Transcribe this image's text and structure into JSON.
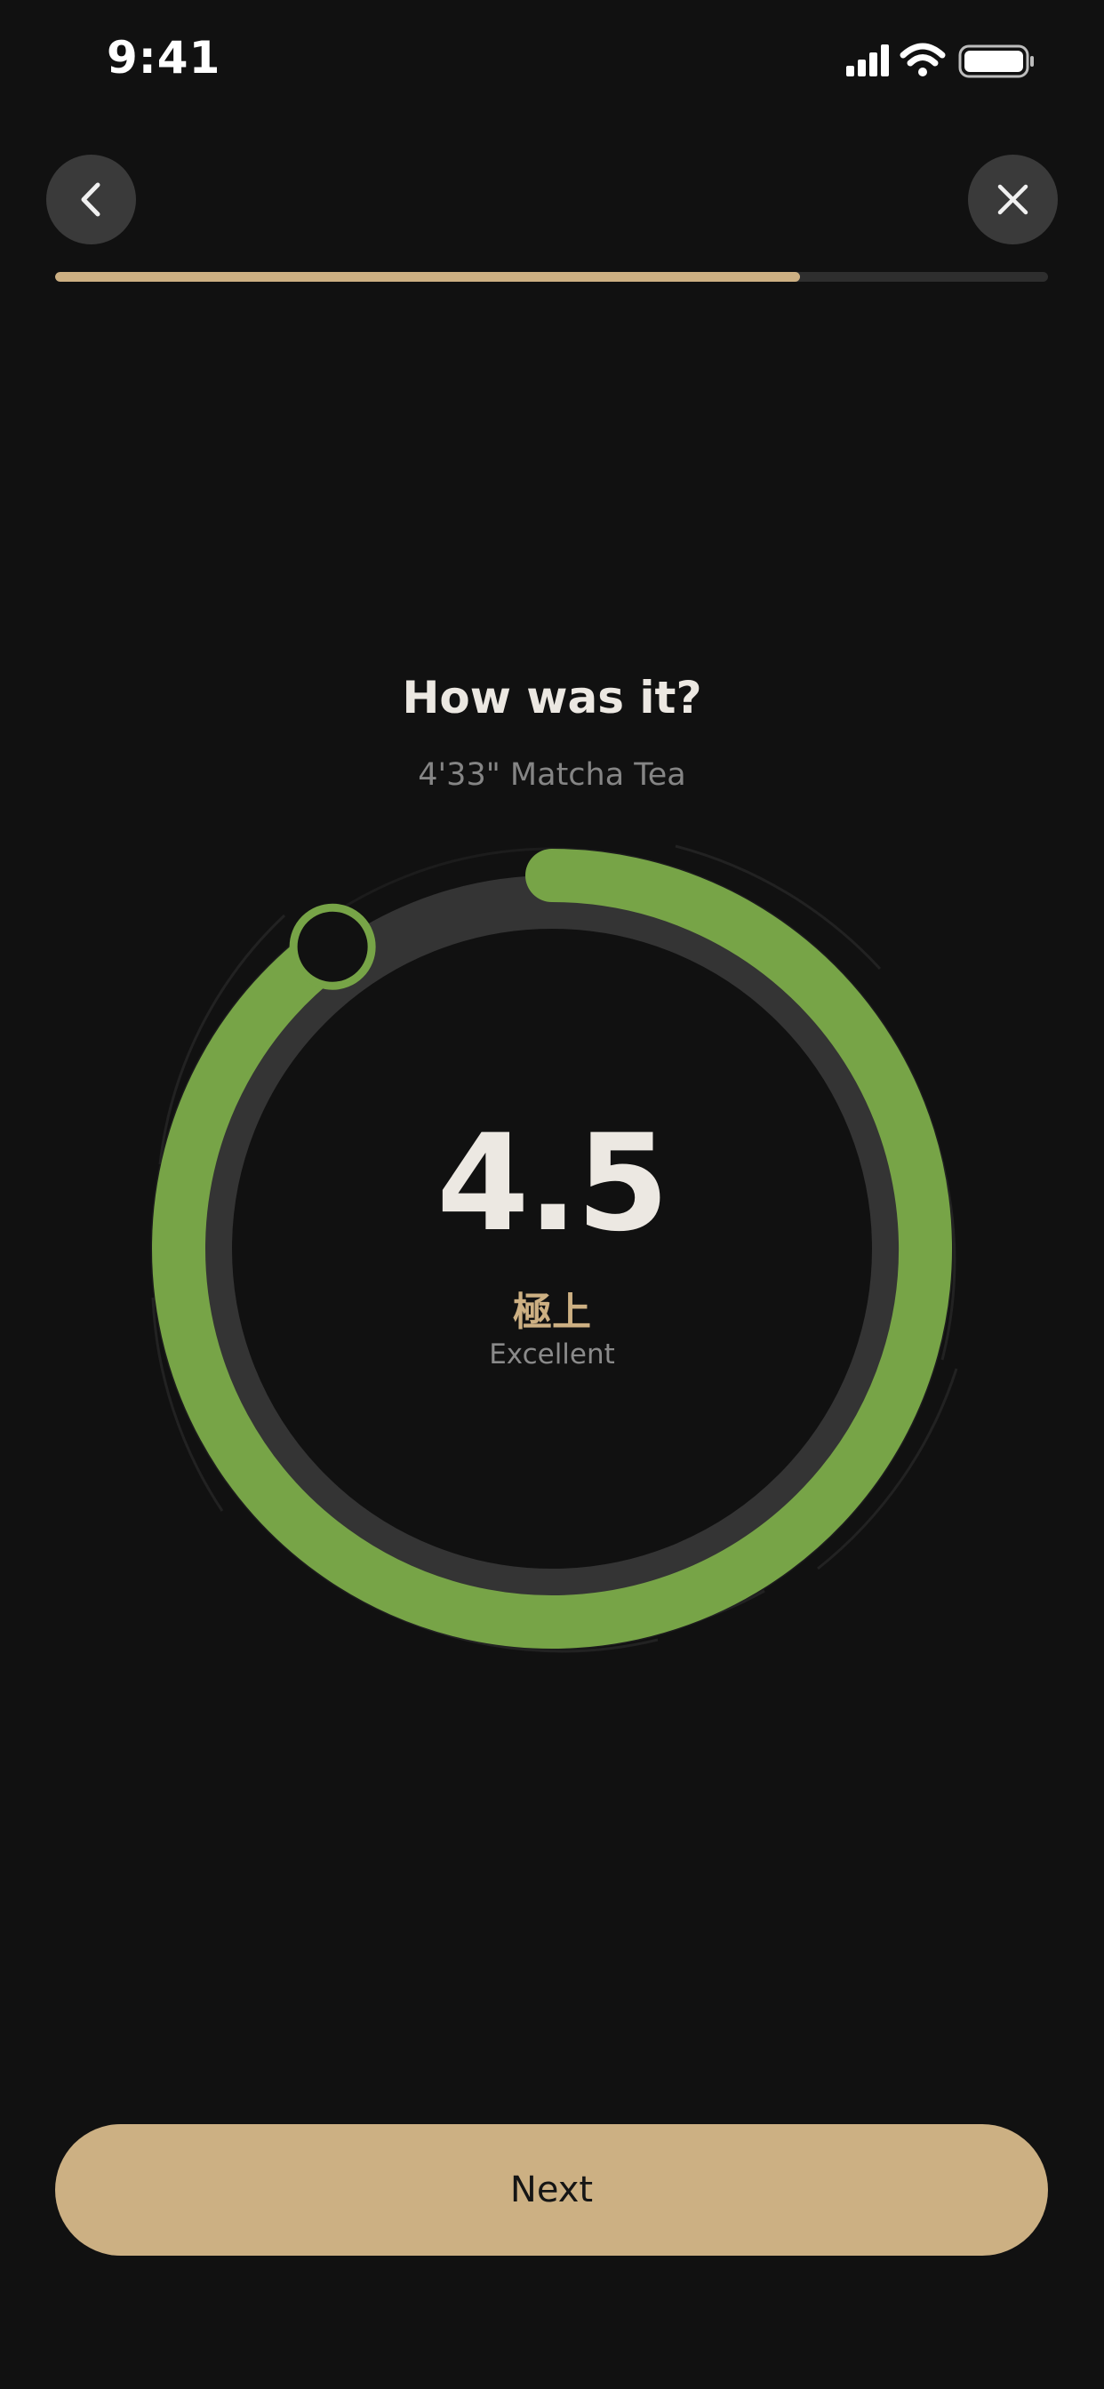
{
  "status_bar": {
    "time": "9:41",
    "icons": [
      "cellular-signal-icon",
      "wifi-icon",
      "battery-icon"
    ]
  },
  "header": {
    "back_icon": "chevron-left-icon",
    "close_icon": "close-icon",
    "progress": 0.75
  },
  "rating": {
    "title": "How was it?",
    "subtitle": "4'33\" Matcha Tea",
    "score": "4.5",
    "label_jp": "極上",
    "label_en": "Excellent",
    "dial_fill": 0.9
  },
  "footer": {
    "next_label": "Next"
  },
  "colors": {
    "background": "#111111",
    "accent_gold": "#CDB083",
    "dial_green": "#77A447",
    "track_gray": "#2E2E2E",
    "button_gray": "#3A3A3A"
  }
}
